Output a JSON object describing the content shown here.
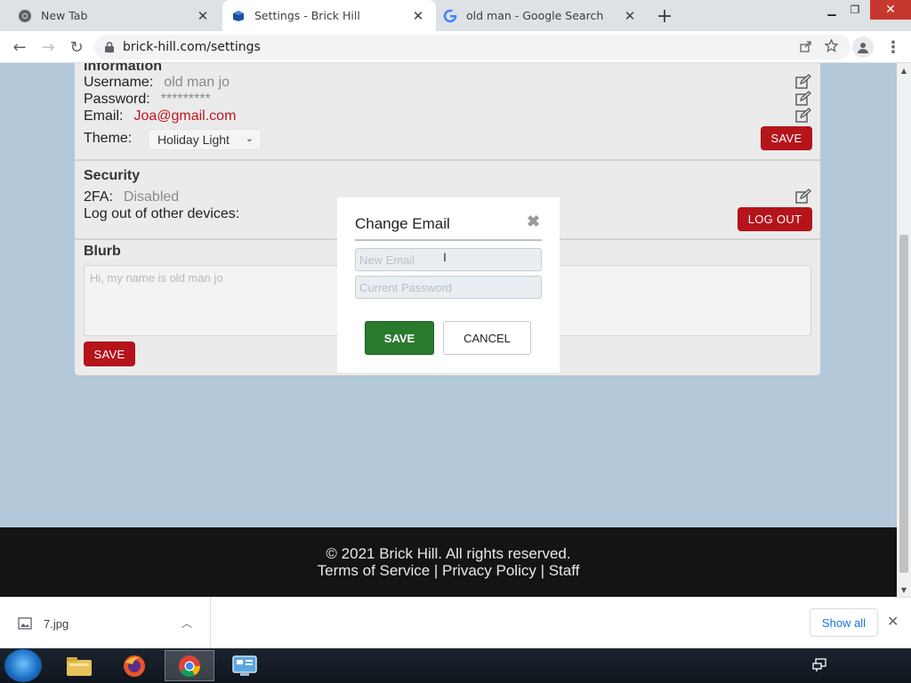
{
  "browser": {
    "tabs": [
      {
        "title": "New Tab",
        "favicon": "chrome-icon"
      },
      {
        "title": "Settings - Brick Hill",
        "favicon": "brick-hill-icon"
      },
      {
        "title": "old man - Google Search",
        "favicon": "google-icon"
      }
    ],
    "active_tab": 1,
    "url": "brick-hill.com/settings"
  },
  "settings": {
    "information": {
      "heading": "Information",
      "username_label": "Username:",
      "username_value": "old man jo",
      "password_label": "Password:",
      "password_value": "*********",
      "email_label": "Email:",
      "email_value": "Joa@gmail.com",
      "theme_label": "Theme:",
      "theme_value": "Holiday Light",
      "save_label": "SAVE"
    },
    "security": {
      "heading": "Security",
      "twofa_label": "2FA:",
      "twofa_value": "Disabled",
      "logout_label": "Log out of other devices:",
      "logout_button": "LOG OUT"
    },
    "blurb": {
      "heading": "Blurb",
      "placeholder": "Hi, my name is old man jo",
      "save_label": "SAVE"
    }
  },
  "modal": {
    "title": "Change Email",
    "new_email_placeholder": "New Email",
    "current_password_placeholder": "Current Password",
    "save_label": "SAVE",
    "cancel_label": "CANCEL"
  },
  "footer": {
    "copyright": "© 2021 Brick Hill. All rights reserved.",
    "links": "Terms of Service | Privacy Policy | Staff"
  },
  "downloads": {
    "file_name": "7.jpg",
    "show_all": "Show all"
  },
  "taskbar": {
    "apps": [
      "file-explorer-icon",
      "firefox-icon",
      "chrome-icon",
      "control-panel-icon"
    ]
  },
  "colors": {
    "accent_red": "#b5141b",
    "accent_green": "#2a7a2e",
    "email_red": "#c0151f",
    "footer_bg": "#141414"
  }
}
